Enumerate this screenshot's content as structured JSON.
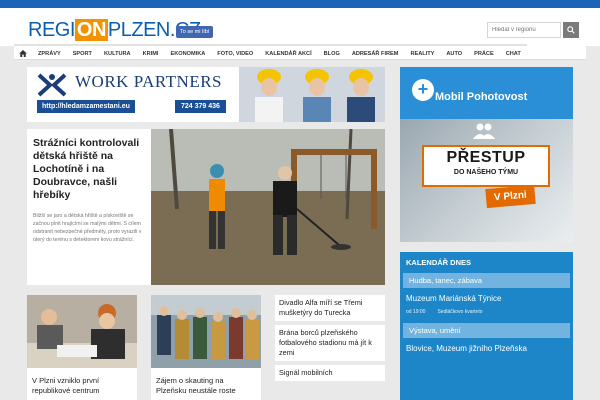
{
  "header": {
    "logo_part1": "REGI",
    "logo_part2": "ON",
    "logo_part3": "PLZEN.CZ",
    "fb_like": "To se mi líbí",
    "search_placeholder": "Hledat v regionu"
  },
  "nav": {
    "items": [
      "ZPRÁVY",
      "SPORT",
      "KULTURA",
      "KRIMI",
      "EKONOMIKA",
      "FOTO, VIDEO",
      "KALENDÁŘ AKCÍ",
      "BLOG",
      "ADRESÁŘ FIREM",
      "REALITY",
      "AUTO",
      "PRÁCE",
      "CHAT"
    ]
  },
  "banner": {
    "title": "WORK PARTNERS",
    "url": "http://hledamzamestani.eu",
    "phone": "724 379 436"
  },
  "ad_side": {
    "title": "Mobil Pohotovost",
    "headline": "PŘESTUP",
    "subline": "DO NAŠEHO TÝMU",
    "city": "V Plzni"
  },
  "lead": {
    "title": "Strážníci kontrolovali dětská hřiště na Lochotíně i na Doubravce, našli hřebíky",
    "perex": "Bližší se jaro a dětská hřiště a pískoviště se začnou plnit hrajícími se malými dětmi. S cílem odstranit nebezpečné předměty, proto vyrazili v úterý do terénu s detektorem kovu strážníci."
  },
  "calendar": {
    "title": "KALENDÁŘ DNES",
    "category1": "Hudba, tanec, zábava",
    "event1_place": "Muzeum Mariánská Týnice",
    "event1_time": "od 19:00",
    "event1_name": "Sedláčkovo kvarteto",
    "category2": "Výstava, umění",
    "event2_place": "Blovice, Muzeum jižního Plzeňska"
  },
  "cards": [
    {
      "title": "V Plzni vzniklo první republikové centrum"
    },
    {
      "title": "Zájem o skauting na Plzeňsku neustále roste"
    }
  ],
  "headlines": [
    "Divadlo Alfa míří se Třemi mušketýry do Turecka",
    "Brána borců plzeňského fotbalového stadionu má jít k zemi",
    "Signál mobilních"
  ],
  "colors": {
    "brand_blue": "#1b64b6",
    "accent_orange": "#f39200",
    "calendar_blue": "#1c86c9"
  }
}
